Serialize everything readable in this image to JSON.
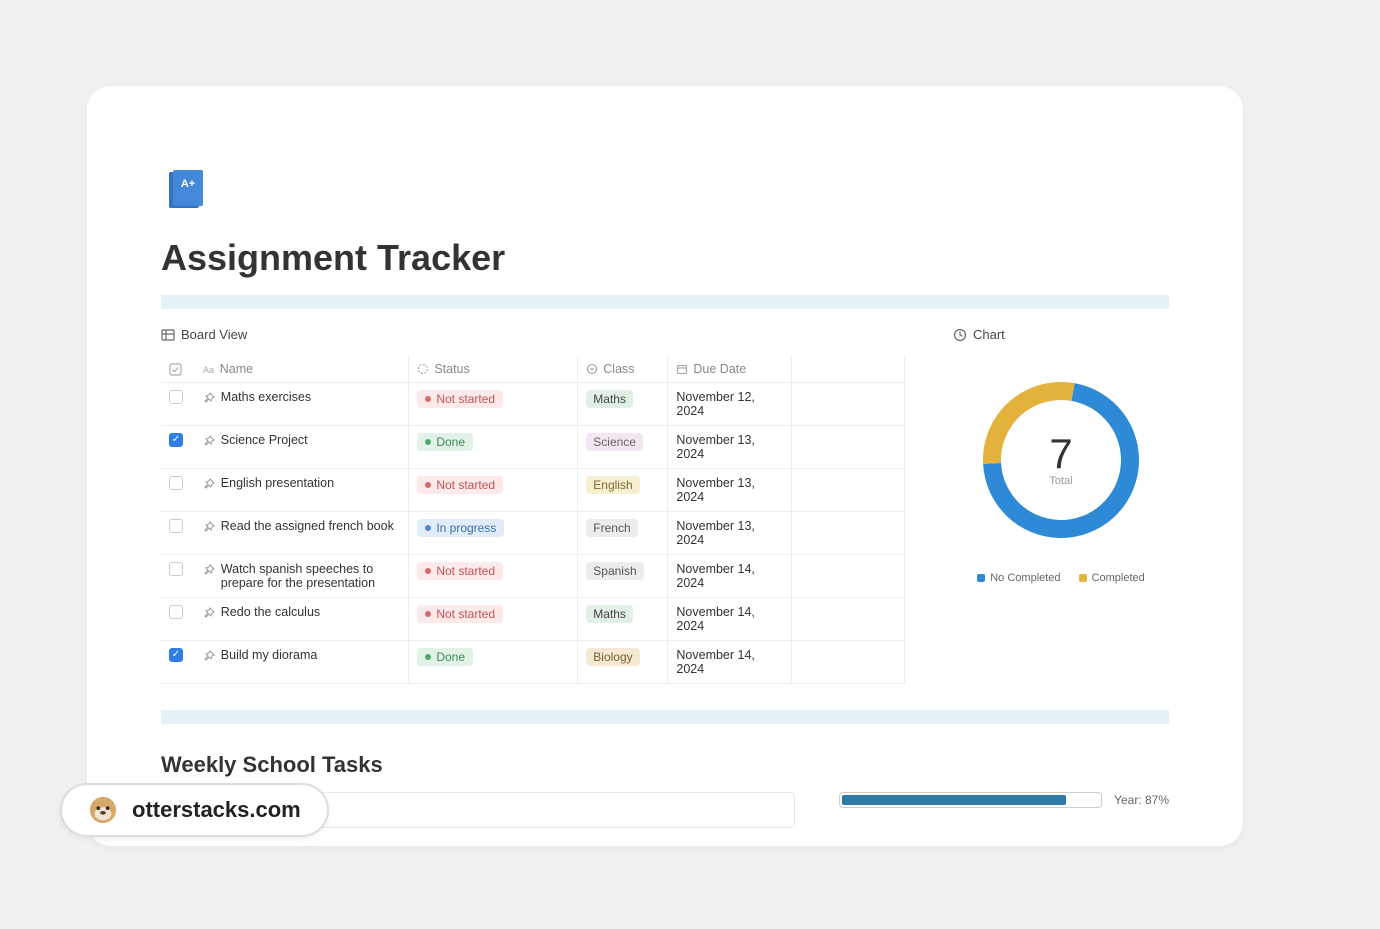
{
  "page": {
    "title": "Assignment Tracker",
    "icon_text": "A+"
  },
  "views": {
    "board_view": "Board View",
    "chart": "Chart"
  },
  "table": {
    "columns": {
      "name": "Name",
      "status": "Status",
      "class": "Class",
      "due": "Due Date"
    },
    "rows": [
      {
        "checked": false,
        "name": "Maths exercises",
        "status": "Not started",
        "status_key": "not-started",
        "class": "Maths",
        "class_key": "maths",
        "due": "November 12, 2024"
      },
      {
        "checked": true,
        "name": "Science Project",
        "status": "Done",
        "status_key": "done",
        "class": "Science",
        "class_key": "science",
        "due": "November 13, 2024"
      },
      {
        "checked": false,
        "name": "English presentation",
        "status": "Not started",
        "status_key": "not-started",
        "class": "English",
        "class_key": "english",
        "due": "November 13, 2024"
      },
      {
        "checked": false,
        "name": "Read the assigned french book",
        "status": "In progress",
        "status_key": "in-progress",
        "class": "French",
        "class_key": "french",
        "due": "November 13, 2024"
      },
      {
        "checked": false,
        "name": "Watch spanish speeches to prepare for the presentation",
        "status": "Not started",
        "status_key": "not-started",
        "class": "Spanish",
        "class_key": "spanish",
        "due": "November 14, 2024"
      },
      {
        "checked": false,
        "name": "Redo the calculus",
        "status": "Not started",
        "status_key": "not-started",
        "class": "Maths",
        "class_key": "maths",
        "due": "November 14, 2024"
      },
      {
        "checked": true,
        "name": "Build my diorama",
        "status": "Done",
        "status_key": "done",
        "class": "Biology",
        "class_key": "biology",
        "due": "November 14, 2024"
      }
    ]
  },
  "chart_data": {
    "type": "pie",
    "title": "",
    "total_label": "Total",
    "total_value": "7",
    "series": [
      {
        "name": "No Completed",
        "value": 5,
        "color": "#2e8ad6"
      },
      {
        "name": "Completed",
        "value": 2,
        "color": "#e3b23c"
      }
    ]
  },
  "weekly": {
    "title": "Weekly School Tasks",
    "year_progress": {
      "label": "Year: 87%",
      "percent": 87
    }
  },
  "watermark": {
    "text": "otterstacks.com"
  }
}
